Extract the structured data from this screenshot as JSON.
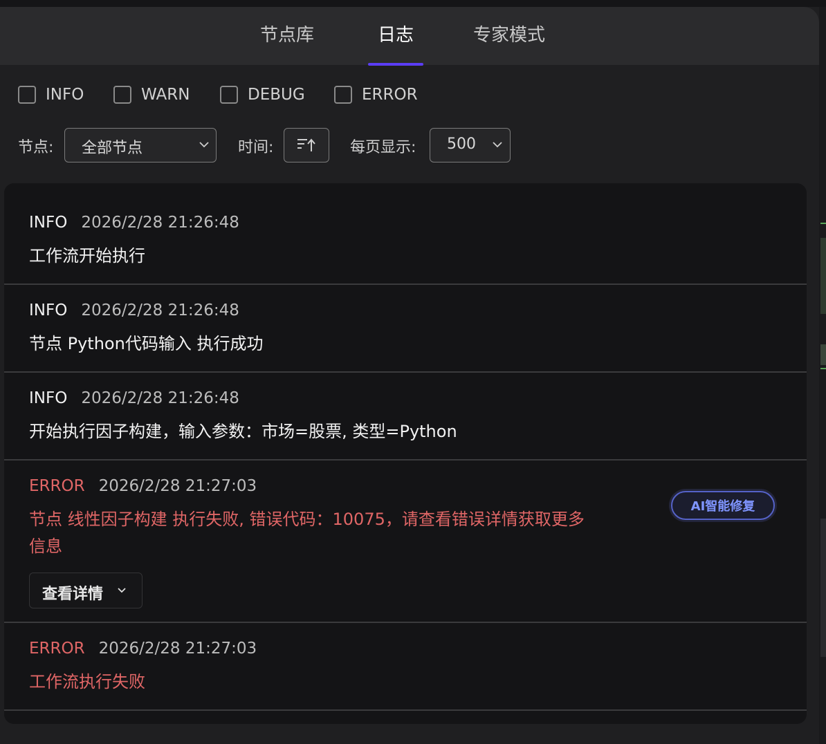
{
  "tabs": [
    {
      "label": "节点库",
      "active": false
    },
    {
      "label": "日志",
      "active": true
    },
    {
      "label": "专家模式",
      "active": false
    }
  ],
  "filters": {
    "levels": [
      {
        "label": "INFO",
        "checked": false
      },
      {
        "label": "WARN",
        "checked": false
      },
      {
        "label": "DEBUG",
        "checked": false
      },
      {
        "label": "ERROR",
        "checked": false
      }
    ]
  },
  "controls": {
    "node_label": "节点:",
    "node_value": "全部节点",
    "time_label": "时间:",
    "per_page_label": "每页显示:",
    "per_page_value": "500"
  },
  "logs": [
    {
      "level": "INFO",
      "time": "2026/2/28 21:26:48",
      "message": "工作流开始执行"
    },
    {
      "level": "INFO",
      "time": "2026/2/28 21:26:48",
      "message": "节点 Python代码输入 执行成功"
    },
    {
      "level": "INFO",
      "time": "2026/2/28 21:26:48",
      "message": "开始执行因子构建，输入参数：市场=股票, 类型=Python"
    },
    {
      "level": "ERROR",
      "time": "2026/2/28 21:27:03",
      "message_line1": "节点 线性因子构建 执行失败, 错误代码：10075，请查看错误详情获取更多",
      "message_line2": "信息",
      "ai_fix_label": "AI智能修复",
      "details_label": "查看详情"
    },
    {
      "level": "ERROR",
      "time": "2026/2/28 21:27:03",
      "message": "工作流执行失败"
    }
  ],
  "colors": {
    "accent": "#5b3df5",
    "error": "#e06666",
    "ai_button": "#7f95ff"
  }
}
